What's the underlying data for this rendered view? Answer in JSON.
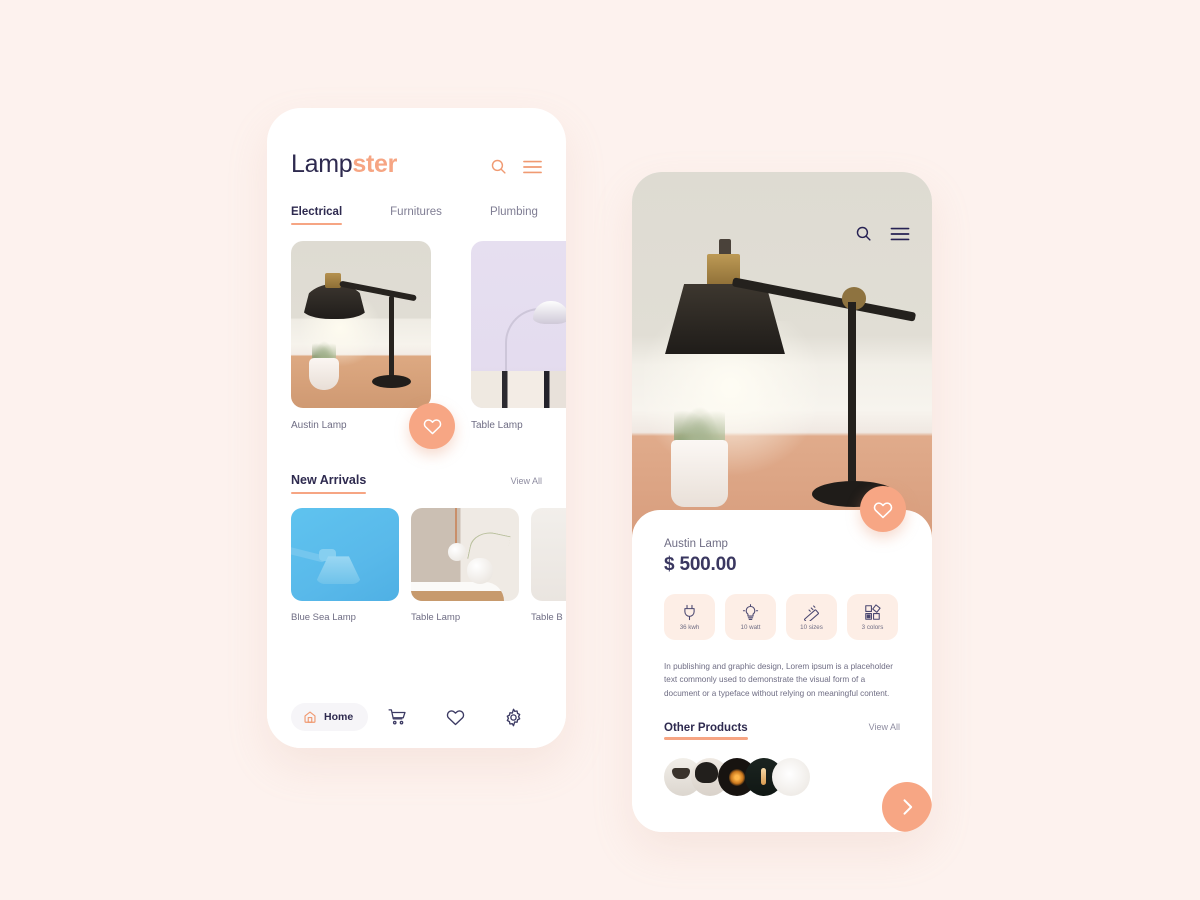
{
  "theme": {
    "background": "#fdf2ee",
    "accent": "#f6a583",
    "ink": "#2e2a4f",
    "muted": "#6f6d84",
    "card": "#ffffff",
    "chip_bg": "#fdeee6"
  },
  "home_screen": {
    "logo": {
      "primary": "Lamp",
      "accent": "ster"
    },
    "header_icons": [
      {
        "name": "search-icon",
        "label": "Search"
      },
      {
        "name": "menu-icon",
        "label": "Menu"
      }
    ],
    "tabs": [
      {
        "label": "Electrical",
        "active": true
      },
      {
        "label": "Furnitures",
        "active": false
      },
      {
        "label": "Plumbing",
        "active": false
      }
    ],
    "featured": [
      {
        "name": "Austin Lamp",
        "scene": "austin"
      },
      {
        "name": "Table Lamp",
        "scene": "table"
      }
    ],
    "favorite_icon": "heart-icon",
    "new_arrivals": {
      "title": "New Arrivals",
      "view_all": "View All",
      "items": [
        {
          "name": "Blue Sea Lamp",
          "scene": "blue"
        },
        {
          "name": "Table Lamp",
          "scene": "pendant"
        },
        {
          "name": "Table B",
          "scene": "edison"
        }
      ]
    },
    "bottom_nav": [
      {
        "label": "Home",
        "icon": "home-icon",
        "active": true
      },
      {
        "label": "Cart",
        "icon": "cart-icon",
        "active": false
      },
      {
        "label": "Favorites",
        "icon": "heart-icon",
        "active": false
      },
      {
        "label": "Settings",
        "icon": "gear-icon",
        "active": false
      }
    ]
  },
  "detail_screen": {
    "header_icons": [
      {
        "name": "search-icon",
        "label": "Search"
      },
      {
        "name": "menu-icon",
        "label": "Menu"
      }
    ],
    "favorite_icon": "heart-icon",
    "product": {
      "name": "Austin Lamp",
      "price": "$ 500.00",
      "description": "In publishing and graphic design, Lorem ipsum is a placeholder text commonly used to demonstrate the visual form of a document or a typeface without relying on meaningful content."
    },
    "specs": [
      {
        "icon": "plug-icon",
        "label": "36 kwh"
      },
      {
        "icon": "bulb-icon",
        "label": "10 watt"
      },
      {
        "icon": "ruler-icon",
        "label": "10 sizes"
      },
      {
        "icon": "swatch-icon",
        "label": "3 colors"
      }
    ],
    "other_products": {
      "title": "Other Products",
      "view_all": "View All",
      "thumbnails": [
        "t1",
        "t2",
        "t3",
        "t4",
        "t5"
      ]
    },
    "next_button_icon": "chevron-right-icon"
  }
}
